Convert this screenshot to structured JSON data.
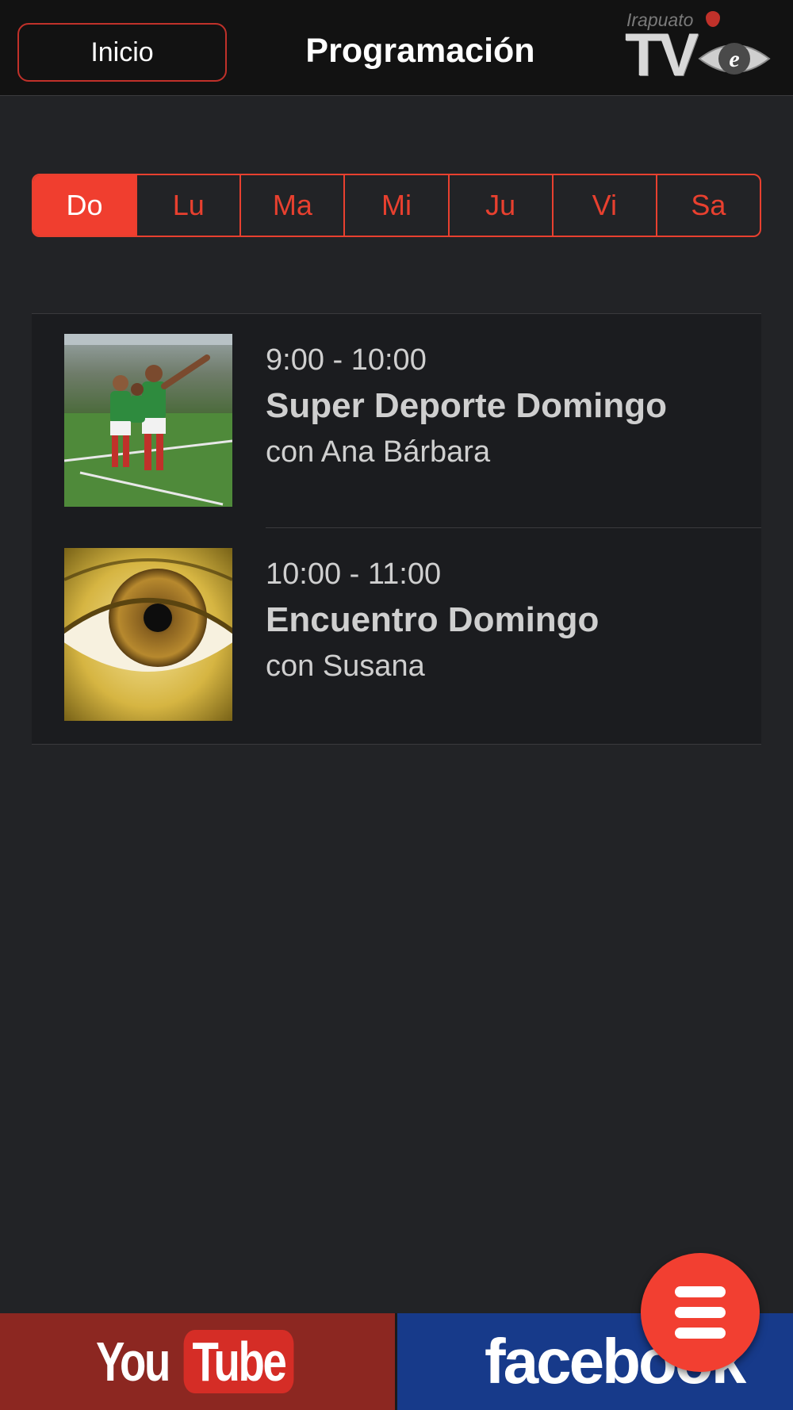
{
  "header": {
    "back_label": "Inicio",
    "title": "Programación",
    "logo_small_text": "Irapuato",
    "logo_tv_text": "TV",
    "logo_eye_letter": "e"
  },
  "days": [
    {
      "label": "Do",
      "active": true
    },
    {
      "label": "Lu",
      "active": false
    },
    {
      "label": "Ma",
      "active": false
    },
    {
      "label": "Mi",
      "active": false
    },
    {
      "label": "Ju",
      "active": false
    },
    {
      "label": "Vi",
      "active": false
    },
    {
      "label": "Sa",
      "active": false
    }
  ],
  "schedule": [
    {
      "time": "9:00 - 10:00",
      "name": "Super Deporte Domingo",
      "host": "con Ana Bárbara",
      "thumbnail": "soccer-players-celebrating"
    },
    {
      "time": "10:00 - 11:00",
      "name": "Encuentro Domingo",
      "host": "con Susana",
      "thumbnail": "golden-eye-closeup"
    }
  ],
  "footer": {
    "youtube_you": "You",
    "youtube_tube": "Tube",
    "facebook": "facebook"
  },
  "fab": {
    "icon": "hamburger-menu-icon"
  },
  "colors": {
    "accent": "#f03e2f",
    "background": "#222326",
    "header": "#121212",
    "youtube_bar": "#8c2721",
    "facebook_bar": "#173a8a"
  }
}
